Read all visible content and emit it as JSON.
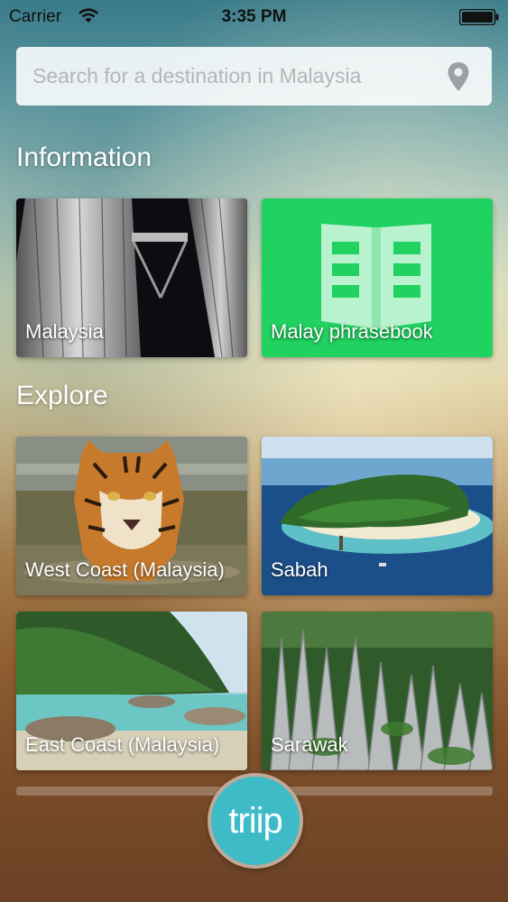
{
  "status_bar": {
    "carrier": "Carrier",
    "time": "3:35 PM"
  },
  "search": {
    "placeholder": "Search for a destination in Malaysia",
    "icon": "location-pin-icon"
  },
  "sections": {
    "information": {
      "title": "Information",
      "tiles": [
        {
          "label": "Malaysia",
          "image": "petronas-towers-night"
        },
        {
          "label": "Malay phrasebook",
          "icon": "open-book-icon",
          "color": "#20d25f"
        }
      ]
    },
    "explore": {
      "title": "Explore",
      "tiles": [
        {
          "label": "West Coast (Malaysia)",
          "image": "tiger-in-water"
        },
        {
          "label": "Sabah",
          "image": "tropical-island-aerial"
        },
        {
          "label": "East Coast (Malaysia)",
          "image": "beach-jungle-coast"
        },
        {
          "label": "Sarawak",
          "image": "limestone-pinnacles-forest"
        }
      ]
    }
  },
  "fab": {
    "label": "triip",
    "color": "#3dbcc8"
  }
}
